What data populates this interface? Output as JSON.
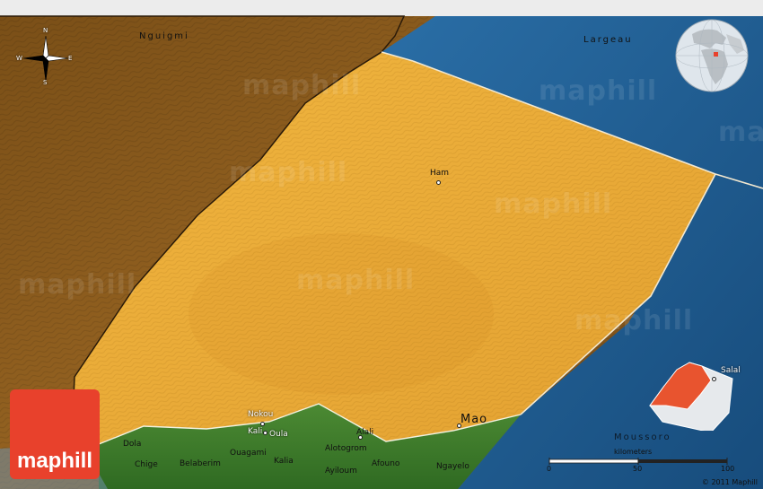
{
  "map": {
    "brand": "maphill",
    "watermark": "maphill",
    "compass": {
      "n": "N",
      "s": "S",
      "e": "E",
      "w": "W"
    },
    "places": [
      {
        "id": "nguigmi",
        "name": "Nguigmi",
        "style": "wide"
      },
      {
        "id": "largeau",
        "name": "Largeau",
        "style": "wide-light"
      },
      {
        "id": "ham",
        "name": "Ham",
        "style": "town"
      },
      {
        "id": "salal",
        "name": "Salal",
        "style": "town-light"
      },
      {
        "id": "moussoro",
        "name": "Moussoro",
        "style": "wide-dark"
      },
      {
        "id": "mao",
        "name": "Mao",
        "style": "big"
      },
      {
        "id": "nokou",
        "name": "Nokou",
        "style": "town-light"
      },
      {
        "id": "kalii",
        "name": "Kali",
        "style": "town-light"
      },
      {
        "id": "oula",
        "name": "Oula",
        "style": "town-light"
      },
      {
        "id": "alali",
        "name": "Alali",
        "style": "town"
      },
      {
        "id": "dola",
        "name": "Dola",
        "style": "town"
      },
      {
        "id": "chige",
        "name": "Chige",
        "style": "town"
      },
      {
        "id": "belaberim",
        "name": "Belaberim",
        "style": "town"
      },
      {
        "id": "ouagami",
        "name": "Ouagami",
        "style": "town"
      },
      {
        "id": "kalia",
        "name": "Kalia",
        "style": "town"
      },
      {
        "id": "alotogrom",
        "name": "Alotogrom",
        "style": "town"
      },
      {
        "id": "ayiloum",
        "name": "Ayiloum",
        "style": "town"
      },
      {
        "id": "afouno",
        "name": "Afouno",
        "style": "town"
      },
      {
        "id": "ngayelo",
        "name": "Ngayelo",
        "style": "town"
      }
    ],
    "scale": {
      "unit": "kilometers",
      "ticks": [
        "0",
        "50",
        "100"
      ]
    },
    "copyright": "© 2011 Maphill",
    "colors": {
      "niger": "#8a5a1c",
      "selected": "#eba935",
      "borkou": "#1f5b8e",
      "kanem": "#3f7a2a",
      "brand": "#e8412c"
    }
  }
}
